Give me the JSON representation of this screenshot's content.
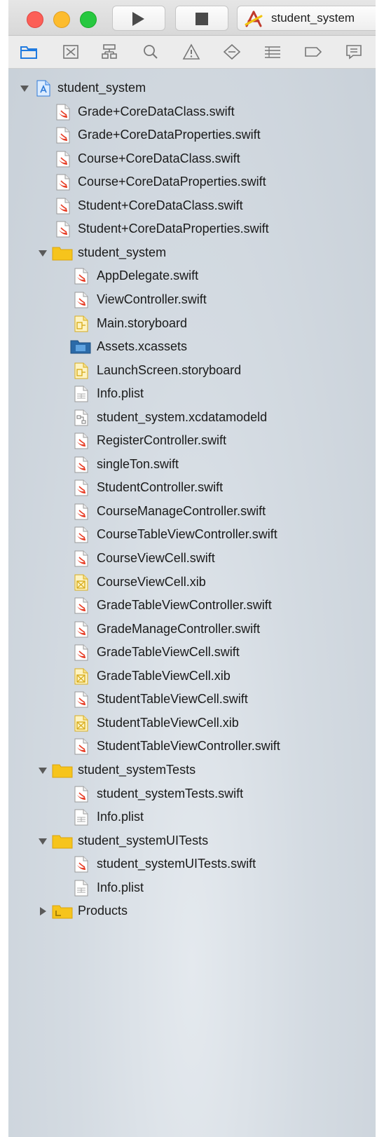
{
  "toolbar": {
    "scheme_label": "student_system"
  },
  "navigator_tabs": [
    "folder-icon",
    "source-control-icon",
    "hierarchy-icon",
    "search-icon",
    "warning-icon",
    "test-diamond-icon",
    "debug-list-icon",
    "breakpoint-icon",
    "report-icon"
  ],
  "tree": {
    "project": "student_system",
    "project_files": [
      "Grade+CoreDataClass.swift",
      "Grade+CoreDataProperties.swift",
      "Course+CoreDataClass.swift",
      "Course+CoreDataProperties.swift",
      "Student+CoreDataClass.swift",
      "Student+CoreDataProperties.swift"
    ],
    "main_group": "student_system",
    "main_files": [
      {
        "name": "AppDelegate.swift",
        "kind": "swift"
      },
      {
        "name": "ViewController.swift",
        "kind": "swift"
      },
      {
        "name": "Main.storyboard",
        "kind": "storyboard"
      },
      {
        "name": "Assets.xcassets",
        "kind": "assets"
      },
      {
        "name": "LaunchScreen.storyboard",
        "kind": "storyboard"
      },
      {
        "name": "Info.plist",
        "kind": "plist"
      },
      {
        "name": "student_system.xcdatamodeld",
        "kind": "datamodel"
      },
      {
        "name": "RegisterController.swift",
        "kind": "swift"
      },
      {
        "name": "singleTon.swift",
        "kind": "swift"
      },
      {
        "name": "StudentController.swift",
        "kind": "swift"
      },
      {
        "name": "CourseManageController.swift",
        "kind": "swift"
      },
      {
        "name": "CourseTableViewController.swift",
        "kind": "swift"
      },
      {
        "name": "CourseViewCell.swift",
        "kind": "swift"
      },
      {
        "name": "CourseViewCell.xib",
        "kind": "xib"
      },
      {
        "name": "GradeTableViewController.swift",
        "kind": "swift"
      },
      {
        "name": "GradeManageController.swift",
        "kind": "swift"
      },
      {
        "name": "GradeTableViewCell.swift",
        "kind": "swift"
      },
      {
        "name": "GradeTableViewCell.xib",
        "kind": "xib"
      },
      {
        "name": "StudentTableViewCell.swift",
        "kind": "swift"
      },
      {
        "name": "StudentTableViewCell.xib",
        "kind": "xib"
      },
      {
        "name": "StudentTableViewController.swift",
        "kind": "swift"
      }
    ],
    "tests_group": "student_systemTests",
    "tests_files": [
      {
        "name": "student_systemTests.swift",
        "kind": "swift"
      },
      {
        "name": "Info.plist",
        "kind": "plist"
      }
    ],
    "uitests_group": "student_systemUITests",
    "uitests_files": [
      {
        "name": "student_systemUITests.swift",
        "kind": "swift"
      },
      {
        "name": "Info.plist",
        "kind": "plist"
      }
    ],
    "products_group": "Products"
  },
  "colors": {
    "accent": "#1f7ae0",
    "folder": "#f5c518",
    "swift": "#e8412a",
    "xib": "#e8b820"
  }
}
